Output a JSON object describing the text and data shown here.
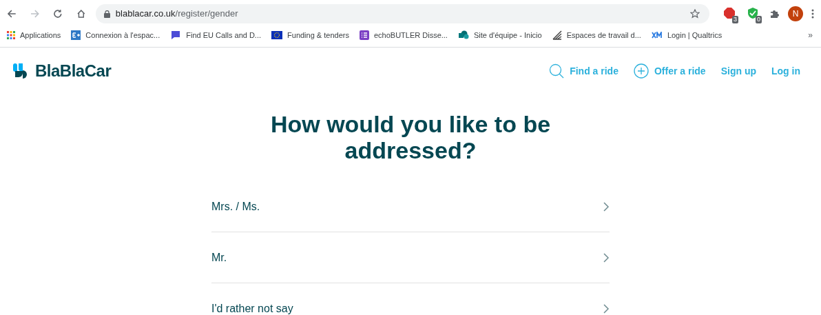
{
  "browser": {
    "url_host": "blablacar.co.uk",
    "url_path": "/register/gender",
    "extension_badges": [
      "3",
      "0"
    ],
    "profile_initial": "N",
    "bookmarks": [
      {
        "label": "Applications",
        "kind": "apps"
      },
      {
        "label": "Connexion à l'espac...",
        "kind": "eplus"
      },
      {
        "label": "Find EU Calls and D...",
        "kind": "eu"
      },
      {
        "label": "Funding & tenders",
        "kind": "flag"
      },
      {
        "label": "echoBUTLER Disse...",
        "kind": "list"
      },
      {
        "label": "Site d'équipe - Inicio",
        "kind": "sharepoint"
      },
      {
        "label": "Espaces de travail d...",
        "kind": "lines"
      },
      {
        "label": "Login | Qualtrics",
        "kind": "xm"
      }
    ],
    "overflow": "»"
  },
  "site": {
    "logo": "BlaBlaCar",
    "nav": [
      {
        "label": "Find a ride",
        "kind": "search"
      },
      {
        "label": "Offer a ride",
        "kind": "plus"
      },
      {
        "label": "Sign up",
        "kind": "text"
      },
      {
        "label": "Log in",
        "kind": "text"
      }
    ]
  },
  "title": "How would you like to be addressed?",
  "options": [
    {
      "label": "Mrs. / Ms."
    },
    {
      "label": "Mr."
    },
    {
      "label": "I'd rather not say"
    }
  ]
}
